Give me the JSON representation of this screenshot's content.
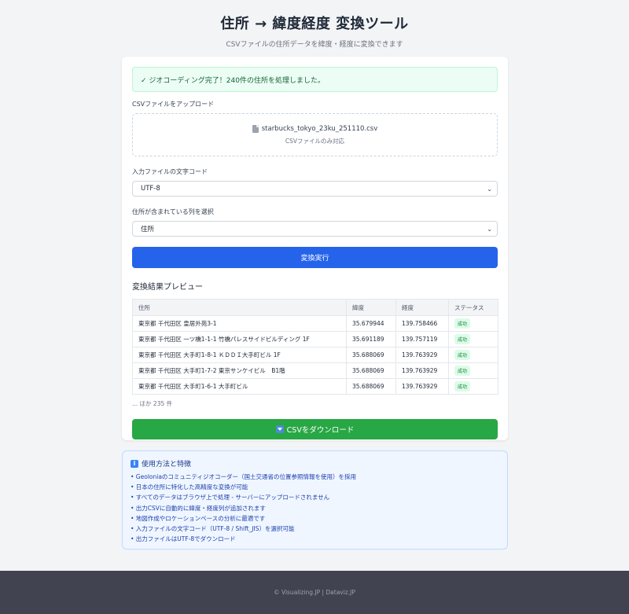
{
  "header": {
    "title": "住所 → 緯度経度 変換ツール",
    "subtitle": "CSVファイルの住所データを緯度・経度に変換できます"
  },
  "alert": {
    "text": "✓ ジオコーディング完了！240件の住所を処理しました。"
  },
  "upload": {
    "label": "CSVファイルをアップロード",
    "file_icon": "file-icon",
    "filename": "starbucks_tokyo_23ku_251110.csv",
    "hint": "CSVファイルのみ対応"
  },
  "encoding": {
    "label": "入力ファイルの文字コード",
    "selected": "UTF-8"
  },
  "column": {
    "label": "住所が含まれている列を選択",
    "selected": "住所"
  },
  "convert_button": "変換実行",
  "preview": {
    "title": "変換結果プレビュー",
    "headers": [
      "住所",
      "緯度",
      "経度",
      "ステータス"
    ],
    "rows": [
      [
        "東京都 千代田区 皇居外苑3-1",
        "35.679944",
        "139.758466",
        "成功"
      ],
      [
        "東京都 千代田区 一ツ橋1-1-1 竹橋パレスサイドビルディング 1F",
        "35.691189",
        "139.757119",
        "成功"
      ],
      [
        "東京都 千代田区 大手町1-8-1 ＫＤＤＩ大手町ビル 1F",
        "35.688069",
        "139.763929",
        "成功"
      ],
      [
        "東京都 千代田区 大手町1-7-2 東京サンケイビル　B1階",
        "35.688069",
        "139.763929",
        "成功"
      ],
      [
        "東京都 千代田区 大手町1-6-1 大手町ビル",
        "35.688069",
        "139.763929",
        "成功"
      ]
    ],
    "more": "... ほか 235 件"
  },
  "download_button": "CSVをダウンロード",
  "info": {
    "title": "使用方法と特徴",
    "items": [
      "• Geoloniaのコミュニティジオコーダー（国土交通省の位置参照情報を使用）を採用",
      "• 日本の住所に特化した高精度な変換が可能",
      "• すべてのデータはブラウザ上で処理 - サーバーにアップロードされません",
      "• 出力CSVに自動的に緯度・経度列が追加されます",
      "• 地図作成やロケーションベースの分析に最適です",
      "• 入力ファイルの文字コード（UTF-8 / Shift_JIS）を選択可能",
      "• 出力ファイルはUTF-8でダウンロード"
    ]
  },
  "footer": {
    "text": "© Visualizing.JP | Dataviz.JP"
  },
  "colors": {
    "primary": "#2563eb",
    "download": "#28a745",
    "success_bg": "#ecfdf5",
    "footer_bg": "#414350"
  }
}
